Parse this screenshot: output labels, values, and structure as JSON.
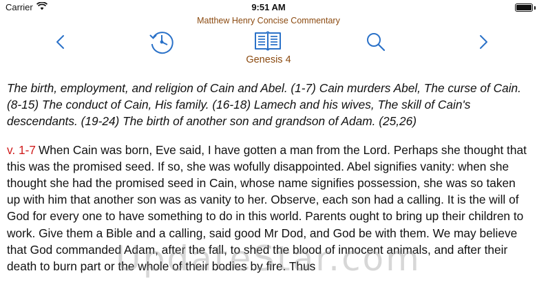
{
  "status_bar": {
    "carrier": "Carrier",
    "time": "9:51 AM"
  },
  "header": {
    "app_title": "Matthew Henry Concise Commentary",
    "chapter": "Genesis 4"
  },
  "toolbar": {
    "accent_color": "#2a71c8",
    "items": [
      {
        "name": "back",
        "icon": "chevron-left-icon"
      },
      {
        "name": "history",
        "icon": "clock-history-icon"
      },
      {
        "name": "library",
        "icon": "open-book-icon"
      },
      {
        "name": "search",
        "icon": "search-icon"
      },
      {
        "name": "forward",
        "icon": "chevron-right-icon"
      }
    ]
  },
  "content": {
    "summary": "The birth, employment, and religion of Cain and Abel. (1-7) Cain murders Abel, The curse of Cain. (8-15) The conduct of Cain, His family. (16-18) Lamech and his wives, The skill of Cain's descendants. (19-24) The birth of another son and grandson of Adam. (25,26)",
    "verse_ref": "v. 1-7",
    "verse_text": "When Cain was born, Eve said, I have gotten a man from the Lord. Perhaps she thought that this was the promised seed. If so, she was wofully disappointed. Abel signifies vanity: when she thought she had the promised seed in Cain, whose name signifies possession, she was so taken up with him that another son was as vanity to her. Observe, each son had a calling. It is the will of God for every one to have something to do in this world. Parents ought to bring up their children to work. Give them a Bible and a calling, said good Mr Dod, and God be with them. We may believe that God commanded Adam, after the fall, to shed the blood of innocent animals, and after their death to burn part or the whole of their bodies by fire. Thus",
    "verse_ref_color": "#d01d1d"
  },
  "watermark": "UpdateStar.com"
}
